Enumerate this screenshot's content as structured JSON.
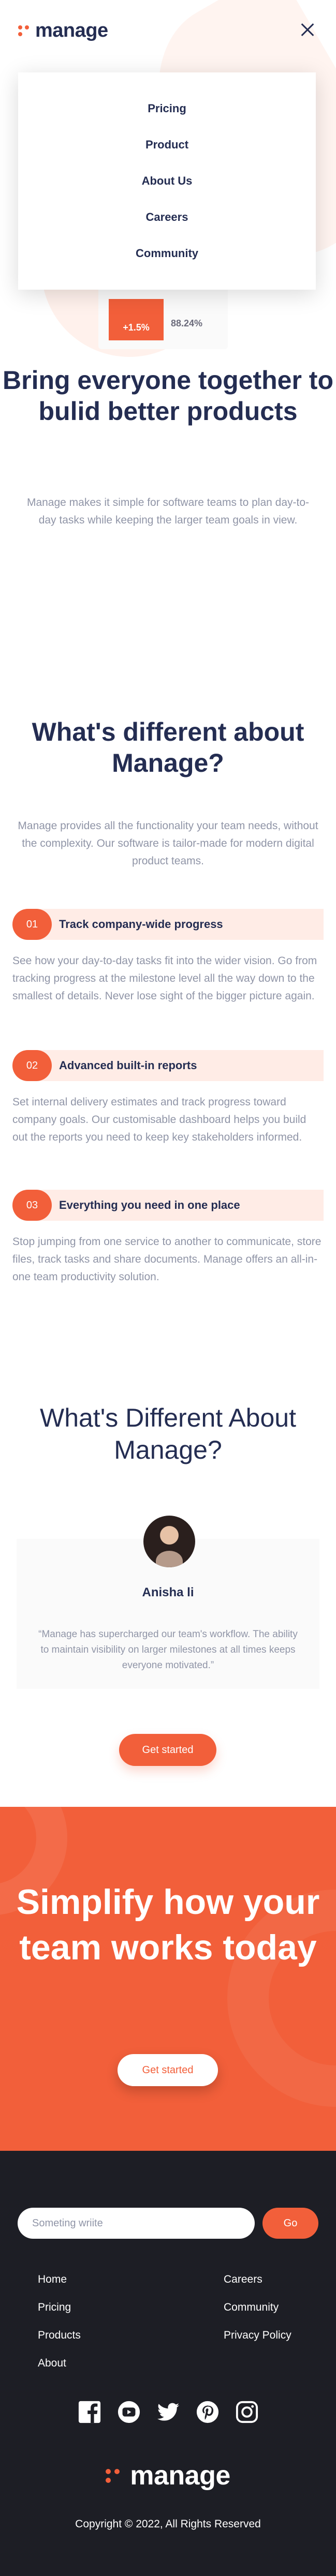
{
  "brand": {
    "name": "manage",
    "accent": "#f25f3a",
    "dark": "#242d52"
  },
  "menu": {
    "items": [
      "Pricing",
      "Product",
      "About Us",
      "Careers",
      "Community"
    ]
  },
  "hero": {
    "stat_up": "+1.5%",
    "stat_value": "88.24%",
    "title": "Bring everyone together to bulid better products",
    "text": "Manage makes it simple for software teams to plan day-to-day tasks while keeping the larger team goals in view."
  },
  "features": {
    "title": "What's different about Manage?",
    "text": "Manage provides all the functionality your team needs, without the complexity. Our software is tailor-made for modern digital product teams.",
    "items": [
      {
        "num": "01",
        "title": "Track company-wide progress",
        "desc": "See how your day-to-day tasks fit into the wider vision. Go from tracking progress at the milestone level all the way down to the smallest of details. Never lose sight of the bigger picture again."
      },
      {
        "num": "02",
        "title": "Advanced built-in reports",
        "desc": "Set internal delivery estimates and track progress toward company goals. Our customisable dashboard helps you build out the reports you need to keep key stakeholders informed."
      },
      {
        "num": "03",
        "title": "Everything you need in one place",
        "desc": "Stop jumping from one service to another to communicate, store files, track tasks and share documents. Manage offers an all-in-one team productivity solution."
      }
    ]
  },
  "testimonials": {
    "title": "What's Different About Manage?",
    "name": "Anisha li",
    "quote": "“Manage has supercharged our team's workflow. The ability to maintain visibility on larger milestones at all times keeps everyone motivated.”",
    "cta_label": "Get started"
  },
  "cta": {
    "title": "Simplify how your team works today",
    "button_label": "Get started"
  },
  "footer": {
    "newsletter_placeholder": "Someting wriite",
    "go_label": "Go",
    "links_left": [
      "Home",
      "Pricing",
      "Products",
      "About"
    ],
    "links_right": [
      "Careers",
      "Community",
      "Privacy Policy"
    ],
    "socials": [
      "facebook-icon",
      "youtube-icon",
      "twitter-icon",
      "pinterest-icon",
      "instagram-icon"
    ],
    "copyright": "Copyright © 2022, All Rights Reserved"
  }
}
